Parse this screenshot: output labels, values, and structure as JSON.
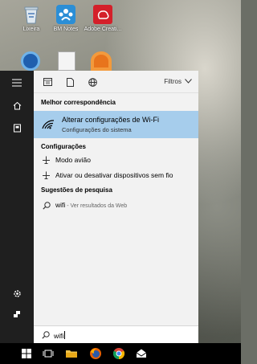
{
  "desktop": {
    "icons": [
      {
        "name": "Lixeira"
      },
      {
        "name": "BM Notes"
      },
      {
        "name": "Adobe Creati..."
      }
    ]
  },
  "panel": {
    "filters_label": "Filtros",
    "best_match": {
      "header": "Melhor correspondência",
      "title": "Alterar configurações de Wi-Fi",
      "subtitle": "Configurações do sistema"
    },
    "settings": {
      "header": "Configurações",
      "items": [
        {
          "label": "Modo avião"
        },
        {
          "label": "Ativar ou desativar dispositivos sem fio"
        }
      ]
    },
    "suggestions": {
      "header": "Sugestões de pesquisa",
      "items": [
        {
          "term": "wifi",
          "detail": " - Ver resultados da Web"
        }
      ]
    },
    "search": {
      "value": "wifi"
    }
  },
  "colors": {
    "highlight": "#a6cdec",
    "rail": "#1f1f1f",
    "taskbar": "#000000"
  }
}
